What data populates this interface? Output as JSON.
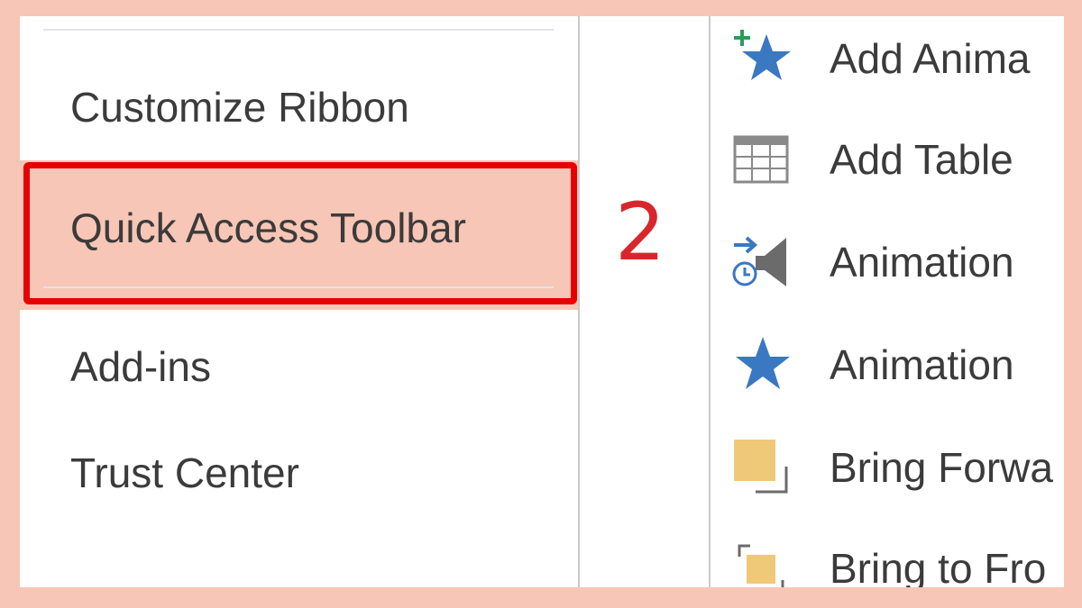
{
  "nav": {
    "items": [
      {
        "label": "Customize Ribbon"
      },
      {
        "label": "Quick Access Toolbar",
        "selected": true
      },
      {
        "label": "Add-ins"
      },
      {
        "label": "Trust Center"
      }
    ]
  },
  "step_marker": "2",
  "commands": [
    {
      "label": "Add Anima",
      "icon": "add-animation-star-icon"
    },
    {
      "label": "Add Table",
      "icon": "table-grid-icon"
    },
    {
      "label": "Animation",
      "icon": "animation-trigger-icon"
    },
    {
      "label": "Animation",
      "icon": "animation-star-icon"
    },
    {
      "label": "Bring Forwa",
      "icon": "bring-forward-icon"
    },
    {
      "label": "Bring to Fro",
      "icon": "bring-to-front-icon"
    }
  ],
  "colors": {
    "background": "#f8c6b6",
    "selected_item": "#f8c6b6",
    "highlight_border": "#e60000",
    "step_marker": "#d9262c",
    "star_blue": "#3a78c2",
    "shape_gold": "#f0c978"
  }
}
